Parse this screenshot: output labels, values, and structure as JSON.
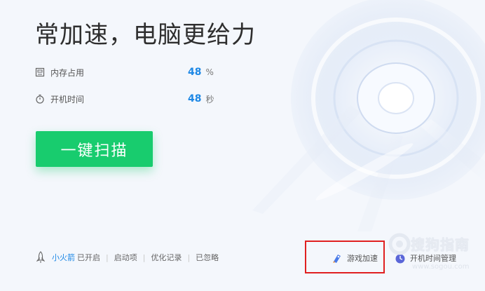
{
  "main": {
    "title": "常加速，电脑更给力",
    "stats": [
      {
        "label": "内存占用",
        "value": "48",
        "unit": "%",
        "icon": "memory-icon"
      },
      {
        "label": "开机时间",
        "value": "48",
        "unit": "秒",
        "icon": "stopwatch-icon"
      }
    ],
    "scan_button": "一键扫描"
  },
  "bottom": {
    "rocket_name": "小火箭",
    "rocket_status": "已开启",
    "links": [
      "启动项",
      "优化记录",
      "已忽略"
    ]
  },
  "tools": [
    {
      "label": "游戏加速",
      "icon": "game-boost-icon"
    },
    {
      "label": "开机时间管理",
      "icon": "boot-time-icon"
    }
  ],
  "watermark": {
    "text": "搜狗指南",
    "url": "www.sogou.com"
  },
  "colors": {
    "accent": "#1e88e5",
    "scan_button": "#18cc6e",
    "highlight": "#e02020"
  }
}
